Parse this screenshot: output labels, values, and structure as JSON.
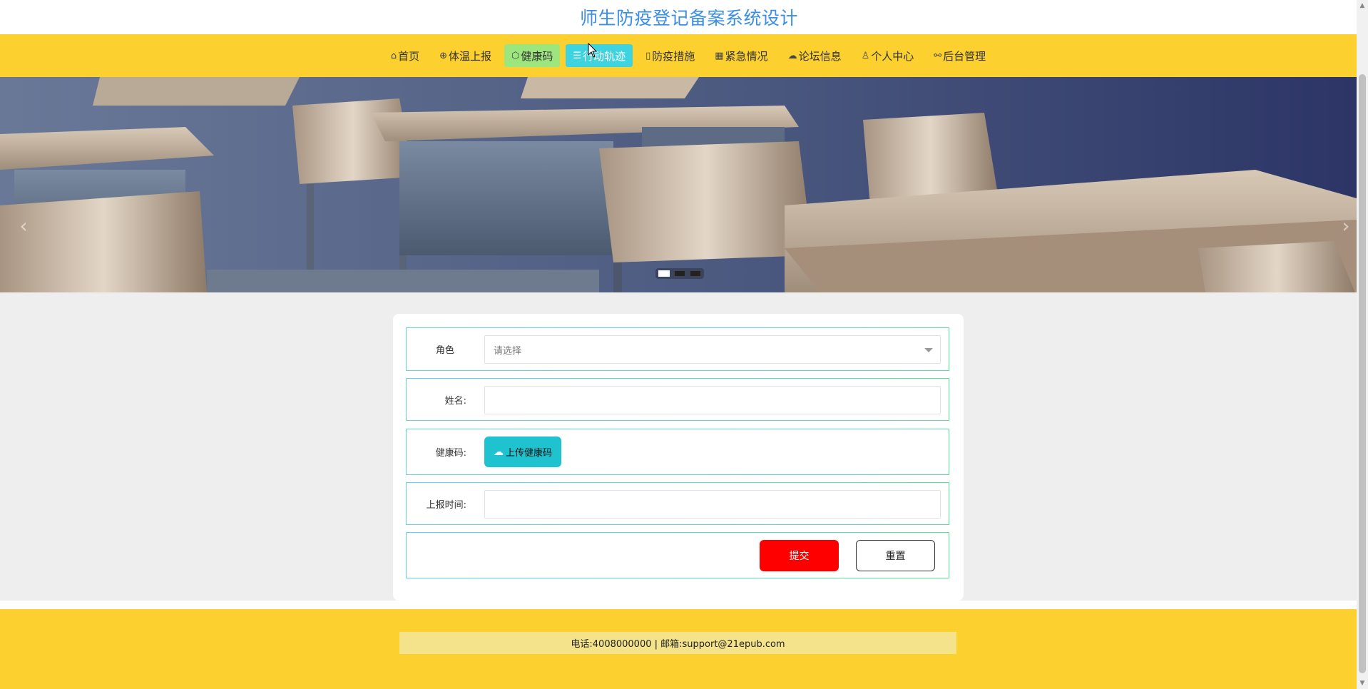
{
  "header": {
    "title": "师生防疫登记备案系统设计"
  },
  "nav": {
    "items": [
      {
        "icon": "home-icon",
        "glyph": "⌂",
        "label": "首页"
      },
      {
        "icon": "globe-icon",
        "glyph": "⊕",
        "label": "体温上报"
      },
      {
        "icon": "box-icon",
        "glyph": "⬡",
        "label": "健康码"
      },
      {
        "icon": "sliders-icon",
        "glyph": "☰",
        "label": "行动轨迹"
      },
      {
        "icon": "clipboard-icon",
        "glyph": "▯",
        "label": "防疫措施"
      },
      {
        "icon": "grid-icon",
        "glyph": "▦",
        "label": "紧急情况"
      },
      {
        "icon": "cloud-icon",
        "glyph": "☁",
        "label": "论坛信息"
      },
      {
        "icon": "user-icon",
        "glyph": "♙",
        "label": "个人中心"
      },
      {
        "icon": "link-icon",
        "glyph": "⚯",
        "label": "后台管理"
      }
    ]
  },
  "banner": {
    "prev": "‹",
    "next": "›",
    "slide_count": 3,
    "active_slide": 1
  },
  "form": {
    "role_label": "角色",
    "role_placeholder": "请选择",
    "name_label": "姓名:",
    "name_value": "",
    "health_code_label": "健康码:",
    "upload_label": "上传健康码",
    "report_time_label": "上报时间:",
    "report_time_value": "",
    "submit_label": "提交",
    "reset_label": "重置"
  },
  "footer": {
    "contact": "电话:4008000000 | 邮箱:support@21epub.com"
  },
  "colors": {
    "nav_bg": "#fbd02f",
    "title": "#3a8ee6",
    "submit": "#ff0000",
    "upload": "#1fc3cf",
    "green_tab": "#9de67e",
    "cyan_tab": "#3fd3df"
  }
}
